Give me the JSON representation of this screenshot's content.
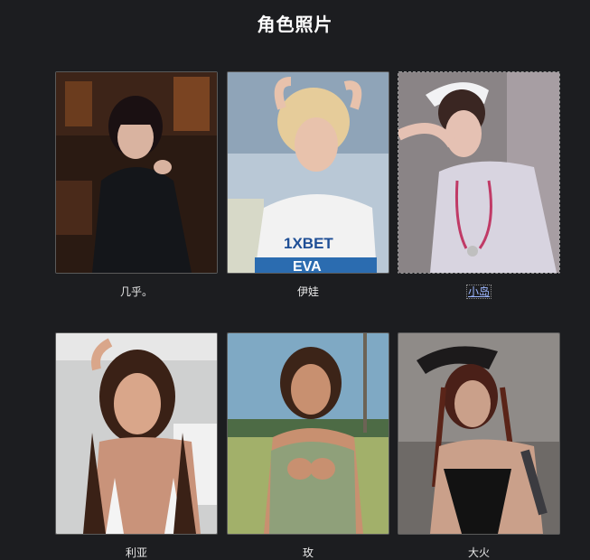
{
  "page": {
    "title": "角色照片"
  },
  "characters": [
    {
      "name": "几乎。",
      "selected": false
    },
    {
      "name": "伊娃",
      "selected": false,
      "shirt_text": "1XBET",
      "shirt_text2": "EVA"
    },
    {
      "name": "小岛",
      "selected": true
    },
    {
      "name": "利亚",
      "selected": false
    },
    {
      "name": "玫",
      "selected": false
    },
    {
      "name": "大火",
      "selected": false
    }
  ],
  "colors": {
    "background": "#1c1d20",
    "title": "#ffffff",
    "selected_label": "#9db7ff"
  }
}
